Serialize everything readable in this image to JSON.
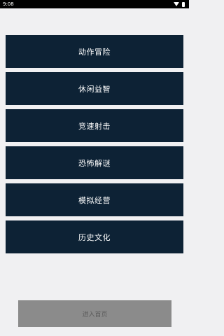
{
  "status_bar": {
    "time": "9:08",
    "icons": [
      "wifi-icon",
      "battery-icon"
    ]
  },
  "categories": [
    {
      "label": "动作冒险"
    },
    {
      "label": "休闲益智"
    },
    {
      "label": "竞速射击"
    },
    {
      "label": "恐怖解谜"
    },
    {
      "label": "模拟经营"
    },
    {
      "label": "历史文化"
    }
  ],
  "enter_button": {
    "label": "进入首页"
  },
  "colors": {
    "category_bg": "#0d2235",
    "category_text": "#ffffff",
    "page_bg": "#f0f0f2",
    "enter_bg": "#8b8b8b",
    "enter_text": "#5b5b5b"
  }
}
